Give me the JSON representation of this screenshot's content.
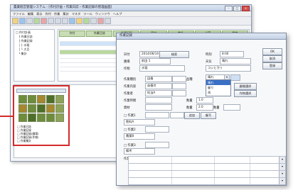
{
  "back_window": {
    "title": "農業経営管理システム - [作付計画・作業日誌・作業記録の管理画面]",
    "menu": [
      "ファイル",
      "編集",
      "表示",
      "作付",
      "作業",
      "集計",
      "マスタ",
      "ツール",
      "ウィンドウ",
      "ヘルプ"
    ],
    "tree_items": [
      "□ 作付計画",
      "　├ 作業日誌",
      "　├ 作業記録",
      "　│ ├ 水稲",
      "　│ └ 大豆",
      "　└ 集計"
    ],
    "tabs": [
      "作付",
      "作業日誌",
      "作業記録",
      "資材",
      "集計",
      "出荷",
      "設定"
    ],
    "callout_lines": [
      "□ 作業日誌",
      "□ 作業記録",
      "□ 作業記録(圃場)",
      "□ 作業記録(作物)",
      "□ 作業集計"
    ]
  },
  "dialog": {
    "title": "作業記録",
    "labels": {
      "date": "日付",
      "time": "時刻",
      "weather": "天気",
      "field": "圃場",
      "crop": "作物",
      "variety": "品種",
      "work_type": "作業種別",
      "work_content": "作業内容",
      "worker": "作業者",
      "worker2": "作業時間",
      "materials": "資材",
      "memo": "備考",
      "amount1": "数量",
      "amount2": "数量",
      "amount3": "数量",
      "detail_table": "作業明細"
    },
    "values": {
      "date": "2014/06/10",
      "time": "8:00",
      "field": "前田 1",
      "crop": "水稲",
      "variety": "コシヒカリ",
      "work_type": "田植",
      "work_content": "苗植付",
      "worker": "担当A",
      "amount1": "1.0",
      "amount2": "2.0",
      "material_a": "肥料A",
      "material_b": "農薬B"
    },
    "buttons": {
      "ok": "OK",
      "cancel": "取消",
      "register": "登録",
      "search": "検索",
      "field_select": "圃場選択",
      "crop_select": "作物選択",
      "add": "追加",
      "copy": "複写"
    },
    "dropdown_options": [
      "晴れ",
      "曇り",
      "雨"
    ],
    "dropdown_selected": "晴れ",
    "checkbox_labels": [
      "□ 作業1",
      "□ 作業2",
      "□ 作業3"
    ]
  }
}
